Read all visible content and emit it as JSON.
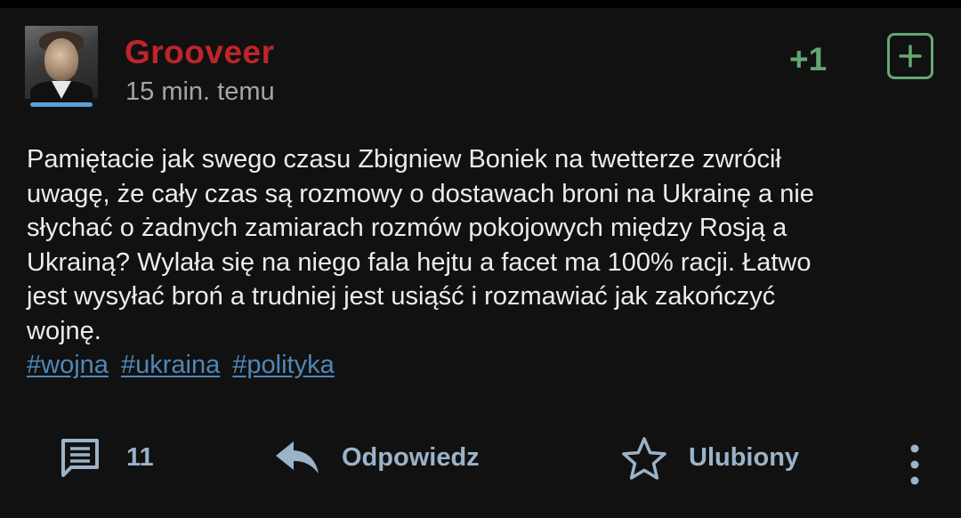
{
  "post": {
    "author": "Grooveer",
    "time_ago": "15 min. temu",
    "vote_count": "+1",
    "content": "Pamiętacie jak swego czasu Zbigniew Boniek na twetterze zwrócił uwagę, że cały czas są rozmowy o dostawach broni na Ukrainę a nie słychać o żadnych zamiarach rozmów pokojowych między Rosją a Ukrainą? Wylała się na niego fala hejtu a facet ma 100% racji. Łatwo jest wysyłać broń a trudniej jest usiąść i rozmawiać jak zakończyć wojnę.",
    "content_lines": [
      "Pamiętacie jak swego czasu Zbigniew Boniek na twetterze zwrócił",
      "uwagę, że cały czas są rozmowy o dostawach broni na Ukrainę a nie",
      "słychać o żadnych zamiarach rozmów pokojowych między Rosją a",
      "Ukrainą? Wylała się na niego fala hejtu a facet ma 100% racji. Łatwo",
      "jest wysyłać broń a trudniej jest usiąść i rozmawiać jak zakończyć",
      "wojnę."
    ],
    "tags": [
      "#wojna",
      "#ukraina",
      "#polityka"
    ]
  },
  "actions": {
    "comments_count": "11",
    "reply_label": "Odpowiedz",
    "favorite_label": "Ulubiony"
  },
  "icons": {
    "plus": "plus-icon",
    "comments": "comment-icon",
    "reply": "reply-arrow-icon",
    "favorite": "star-outline-icon",
    "more": "more-vertical-icon"
  },
  "colors": {
    "background": "#111111",
    "username": "#c0242b",
    "upvote": "#63a872",
    "link": "#4f87b8",
    "action": "#9bb3c8",
    "text": "#ececec",
    "muted": "#a5a5a5"
  }
}
